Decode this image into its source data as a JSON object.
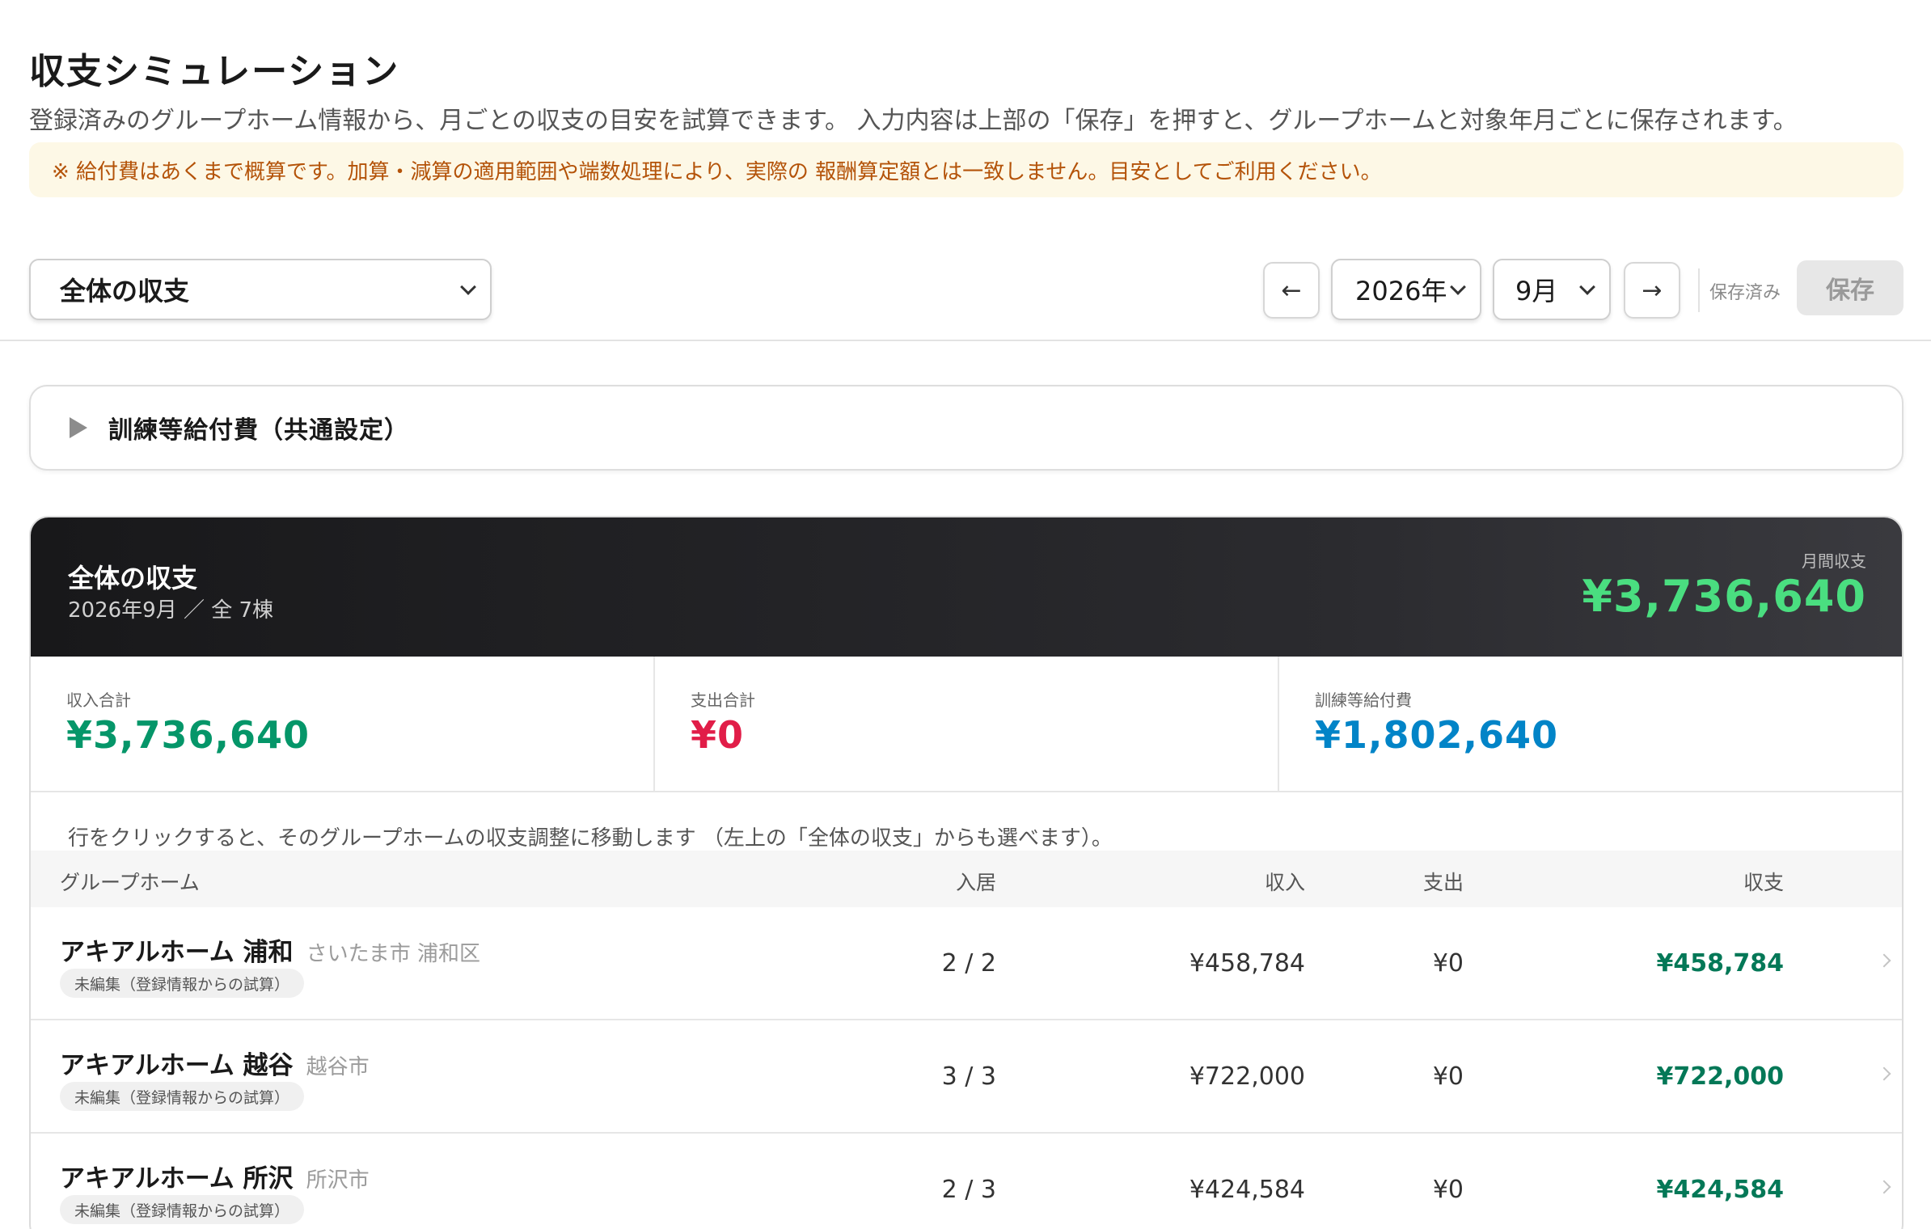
{
  "page": {
    "title": "収支シミュレーション",
    "description": "登録済みのグループホーム情報から、月ごとの収支の目安を試算できます。 入力内容は上部の「保存」を押すと、グループホームと対象年月ごとに保存されます。",
    "notice": "※ 給付費はあくまで概算です。加算・減算の適用範囲や端数処理により、実際の 報酬算定額とは一致しません。目安としてご利用ください。"
  },
  "toolbar": {
    "scope_value": "全体の収支",
    "prev_icon": "←",
    "next_icon": "→",
    "year_value": "2026年",
    "month_value": "9月",
    "save_status": "保存済み",
    "save_label": "保存"
  },
  "accordion": {
    "title": "訓練等給付費（共通設定）"
  },
  "summary": {
    "title": "全体の収支",
    "subtitle": "2026年9月 ／ 全 7棟",
    "monthly_label": "月間収支",
    "monthly_value": "¥3,736,640",
    "stats": [
      {
        "label": "収入合計",
        "value": "¥3,736,640",
        "color": "#059669"
      },
      {
        "label": "支出合計",
        "value": "¥0",
        "color": "#e11d48"
      },
      {
        "label": "訓練等給付費",
        "value": "¥1,802,640",
        "color": "#0284c7"
      }
    ]
  },
  "table": {
    "hint": "行をクリックすると、そのグループホームの収支調整に移動します （左上の「全体の収支」からも選べます）。",
    "headers": {
      "name": "グループホーム",
      "occupancy": "入居",
      "income": "収入",
      "expense": "支出",
      "balance": "収支"
    },
    "rows": [
      {
        "name": "アキアルホーム 浦和",
        "city": "さいたま市 浦和区",
        "badge": "未編集（登録情報からの試算）",
        "occupancy": "2 / 2",
        "income": "¥458,784",
        "expense": "¥0",
        "balance": "¥458,784"
      },
      {
        "name": "アキアルホーム 越谷",
        "city": "越谷市",
        "badge": "未編集（登録情報からの試算）",
        "occupancy": "3 / 3",
        "income": "¥722,000",
        "expense": "¥0",
        "balance": "¥722,000"
      },
      {
        "name": "アキアルホーム 所沢",
        "city": "所沢市",
        "badge": "未編集（登録情報からの試算）",
        "occupancy": "2 / 3",
        "income": "¥424,584",
        "expense": "¥0",
        "balance": "¥424,584"
      }
    ]
  }
}
